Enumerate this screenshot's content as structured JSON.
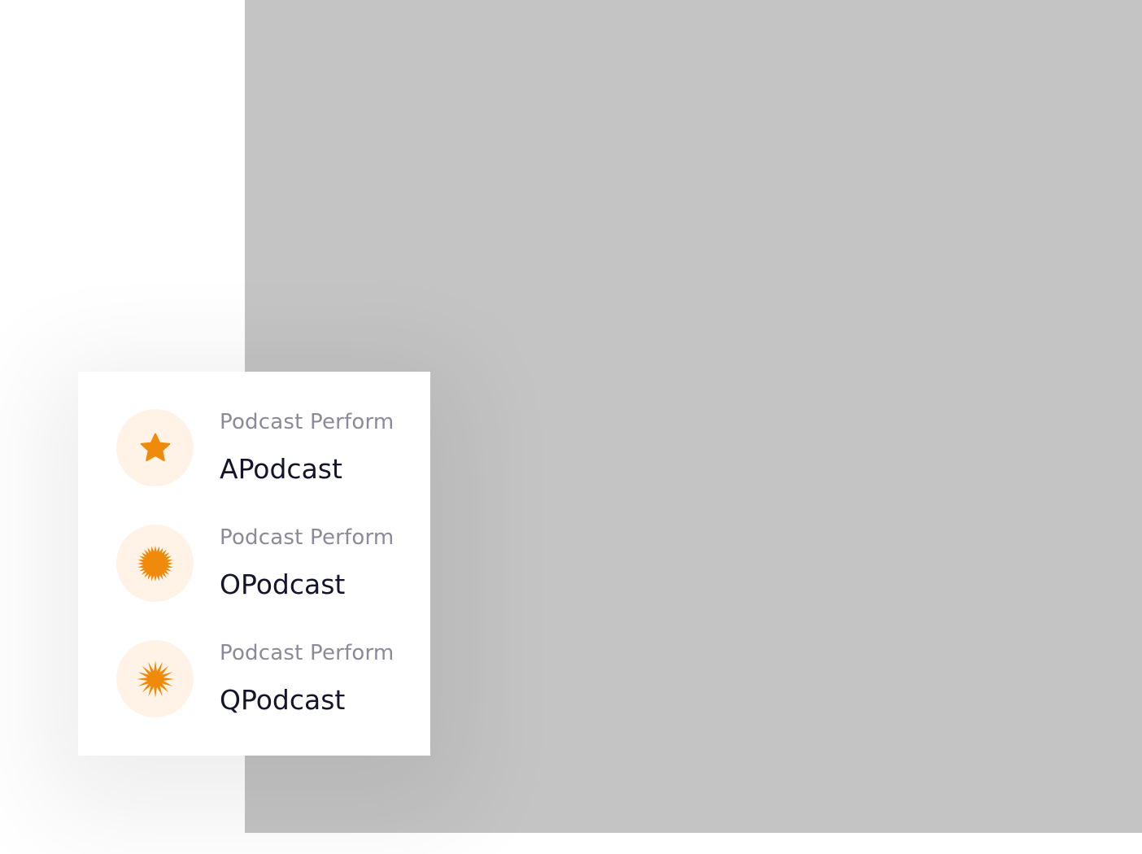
{
  "colors": {
    "placeholder": "#c4c4c4",
    "accent": "#f08a0a",
    "icon_bg": "#fff3e7",
    "label_text": "#8c8a98",
    "name_text": "#14142b"
  },
  "list": {
    "items": [
      {
        "label": "Podcast Perform",
        "name": "APodcast",
        "icon": "star-icon"
      },
      {
        "label": "Podcast Perform",
        "name": "OPodcast",
        "icon": "sunburst-icon"
      },
      {
        "label": "Podcast Perform",
        "name": "QPodcast",
        "icon": "spiky-star-icon"
      }
    ]
  }
}
